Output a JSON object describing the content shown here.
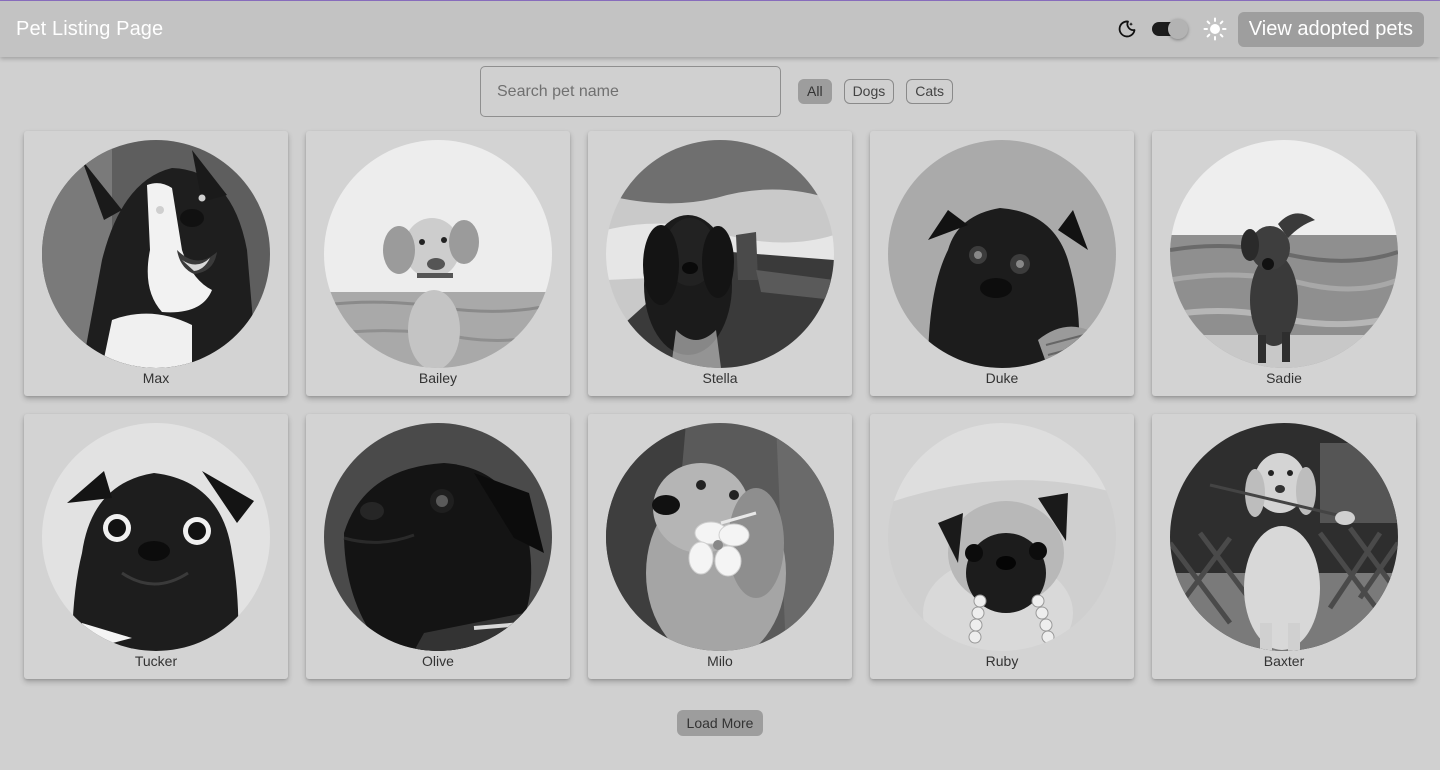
{
  "app": {
    "title": "Pet Listing Page",
    "adopted_button_label": "View adopted pets",
    "theme_toggle": {
      "left_icon": "moon-icon",
      "right_icon": "sun-icon",
      "state": "dark"
    }
  },
  "search": {
    "placeholder": "Search pet name",
    "value": ""
  },
  "filters": [
    {
      "label": "All",
      "active": true
    },
    {
      "label": "Dogs",
      "active": false
    },
    {
      "label": "Cats",
      "active": false
    }
  ],
  "pets": [
    {
      "name": "Max",
      "photo": "border-collie-photo"
    },
    {
      "name": "Bailey",
      "photo": "spaniel-puppy-photo"
    },
    {
      "name": "Stella",
      "photo": "cocker-spaniel-boat-photo"
    },
    {
      "name": "Duke",
      "photo": "black-pug-photo"
    },
    {
      "name": "Sadie",
      "photo": "dog-running-beach-photo"
    },
    {
      "name": "Tucker",
      "photo": "black-pug-portrait-photo"
    },
    {
      "name": "Olive",
      "photo": "black-pug-profile-photo"
    },
    {
      "name": "Milo",
      "photo": "golden-retriever-flower-photo"
    },
    {
      "name": "Ruby",
      "photo": "pug-with-toy-photo"
    },
    {
      "name": "Baxter",
      "photo": "golden-puppy-rose-photo"
    }
  ],
  "load_more_label": "Load More",
  "colors": {
    "background": "#d0d0d0",
    "appbar": "#c3c3c3",
    "accent": "#9d9d9d",
    "top_line": "#8b6fc2"
  }
}
